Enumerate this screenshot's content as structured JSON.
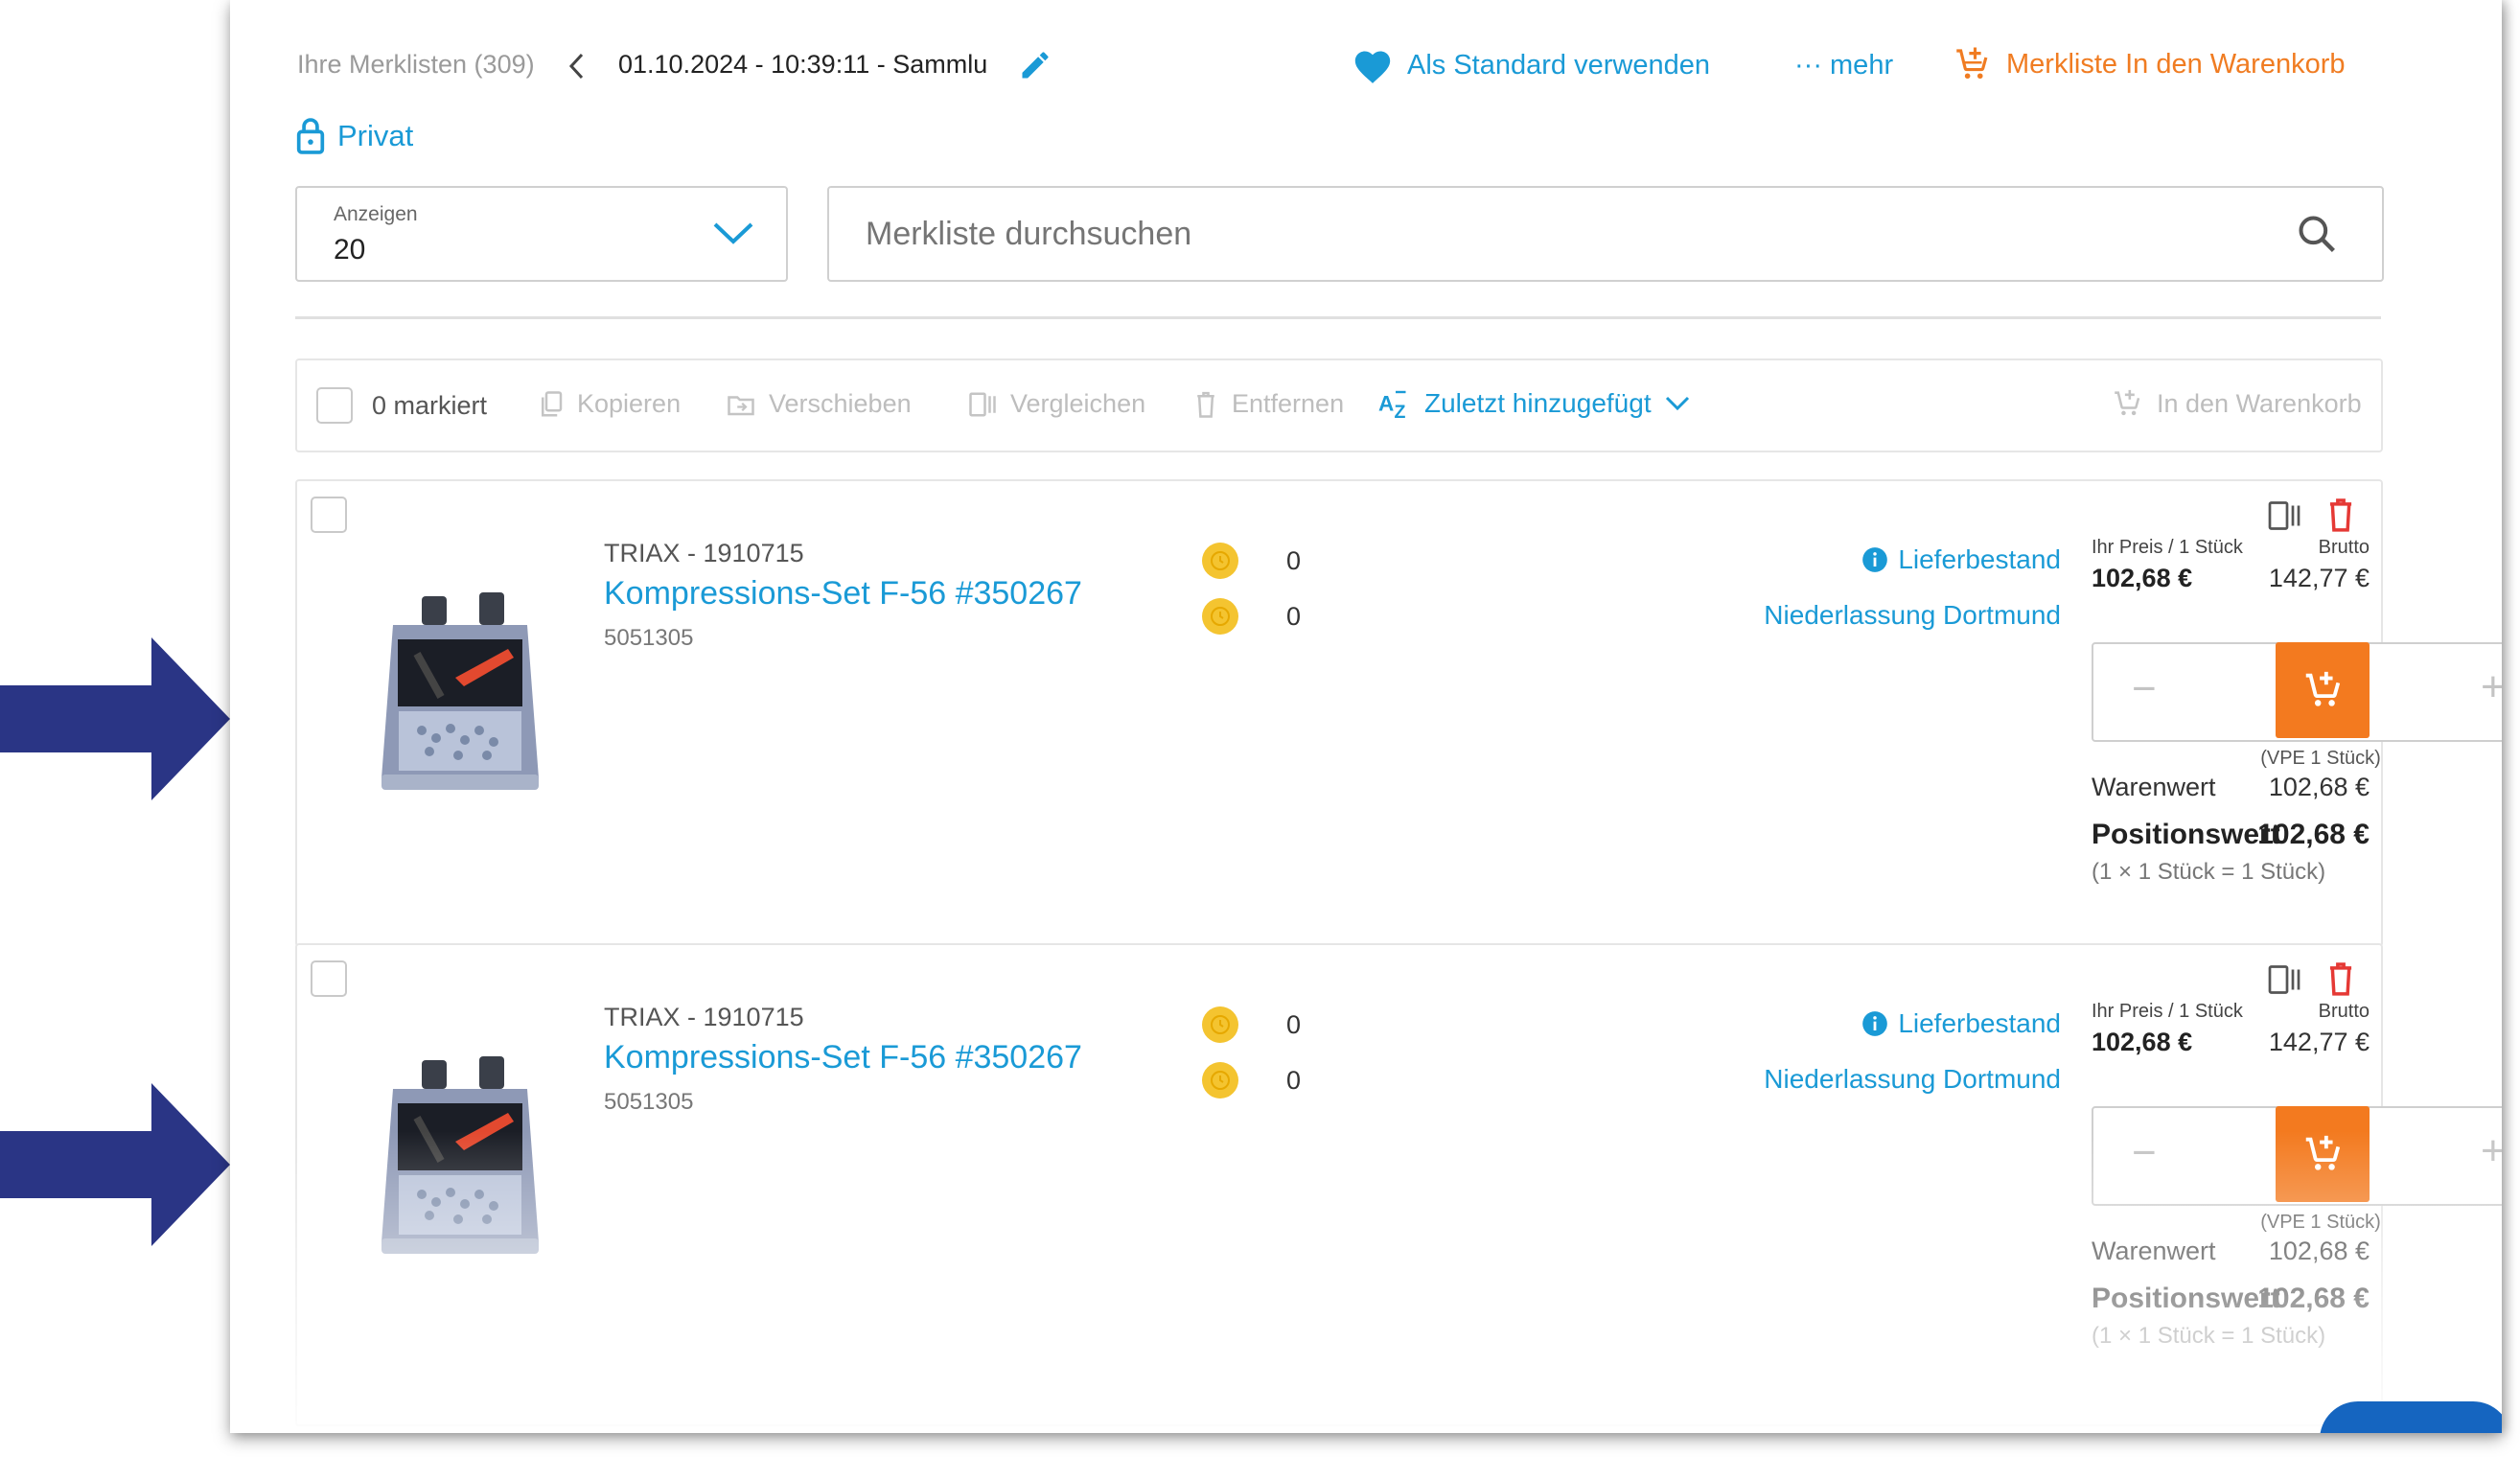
{
  "header": {
    "breadcrumb_label": "Ihre Merklisten (309)",
    "list_title": "01.10.2024 - 10:39:11 - Sammlu",
    "set_default_label": "Als Standard verwenden",
    "more_label": "··· mehr",
    "to_cart_label": "Merkliste In den Warenkorb",
    "privacy_label": "Privat"
  },
  "filters": {
    "show_label": "Anzeigen",
    "show_value": "20",
    "search_placeholder": "Merkliste durchsuchen"
  },
  "toolbar": {
    "marked_label": "0 markiert",
    "copy_label": "Kopieren",
    "move_label": "Verschieben",
    "compare_label": "Vergleichen",
    "remove_label": "Entfernen",
    "sort_label": "Zuletzt hinzugefügt",
    "cart_label": "In den Warenkorb"
  },
  "items": [
    {
      "brand_line": "TRIAX - 1910715",
      "title": "Kompressions-Set F-56 #350267",
      "number": "5051305",
      "stock_1": "0",
      "stock_2": "0",
      "stock_label": "Lieferbestand",
      "branch_label": "Niederlassung Dortmund",
      "price_label": "Ihr Preis / 1 Stück",
      "price": "102,68 €",
      "gross_label": "Brutto",
      "gross_price": "142,77 €",
      "qty": "1",
      "qty_unit": "× 1 Stück",
      "vpe": "(VPE 1 Stück)",
      "warenwert_label": "Warenwert",
      "warenwert": "102,68 €",
      "position_label": "Positionswert",
      "position_value": "102,68 €",
      "position_calc": "(1 × 1 Stück = 1 Stück)"
    },
    {
      "brand_line": "TRIAX - 1910715",
      "title": "Kompressions-Set F-56 #350267",
      "number": "5051305",
      "stock_1": "0",
      "stock_2": "0",
      "stock_label": "Lieferbestand",
      "branch_label": "Niederlassung Dortmund",
      "price_label": "Ihr Preis / 1 Stück",
      "price": "102,68 €",
      "gross_label": "Brutto",
      "gross_price": "142,77 €",
      "qty": "1",
      "qty_unit": "× 1 Stück",
      "vpe": "(VPE 1 Stück)",
      "warenwert_label": "Warenwert",
      "warenwert": "102,68 €",
      "position_label": "Positionswert",
      "position_value": "102,68 €",
      "position_calc": "(1 × 1 Stück = 1 Stück)"
    }
  ],
  "colors": {
    "accent_blue": "#1a9ad6",
    "accent_orange": "#f37a1f",
    "arrow_navy": "#2a3585",
    "coin_yellow": "#f4c430",
    "delete_red": "#e53935"
  },
  "icons": {
    "heart": "heart-icon",
    "cart": "cart-icon",
    "lock": "lock-icon",
    "search": "search-icon",
    "pencil": "pencil-icon",
    "chevron": "chevron-down-icon"
  }
}
